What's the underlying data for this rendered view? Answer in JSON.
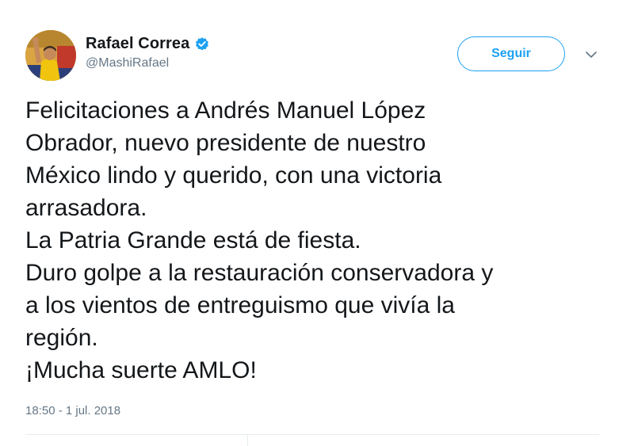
{
  "author": {
    "display_name": "Rafael Correa",
    "handle": "@MashiRafael",
    "verified": true,
    "avatar_icon": "profile-photo"
  },
  "actions": {
    "follow_label": "Seguir",
    "more_menu_icon": "chevron-down-icon"
  },
  "tweet": {
    "text": "Felicitaciones a Andrés Manuel López\nObrador, nuevo presidente de nuestro\nMéxico lindo y querido, con una victoria\narrasadora.\nLa Patria Grande está de fiesta.\nDuro golpe a la restauración conservadora y\na los vientos de entreguismo que vivía la\nregión.\n¡Mucha suerte AMLO!",
    "timestamp": "18:50 - 1 jul. 2018"
  },
  "colors": {
    "accent": "#1da1f2",
    "text": "#14171a",
    "secondary_text": "#657786",
    "divider": "#e6ecf0"
  }
}
